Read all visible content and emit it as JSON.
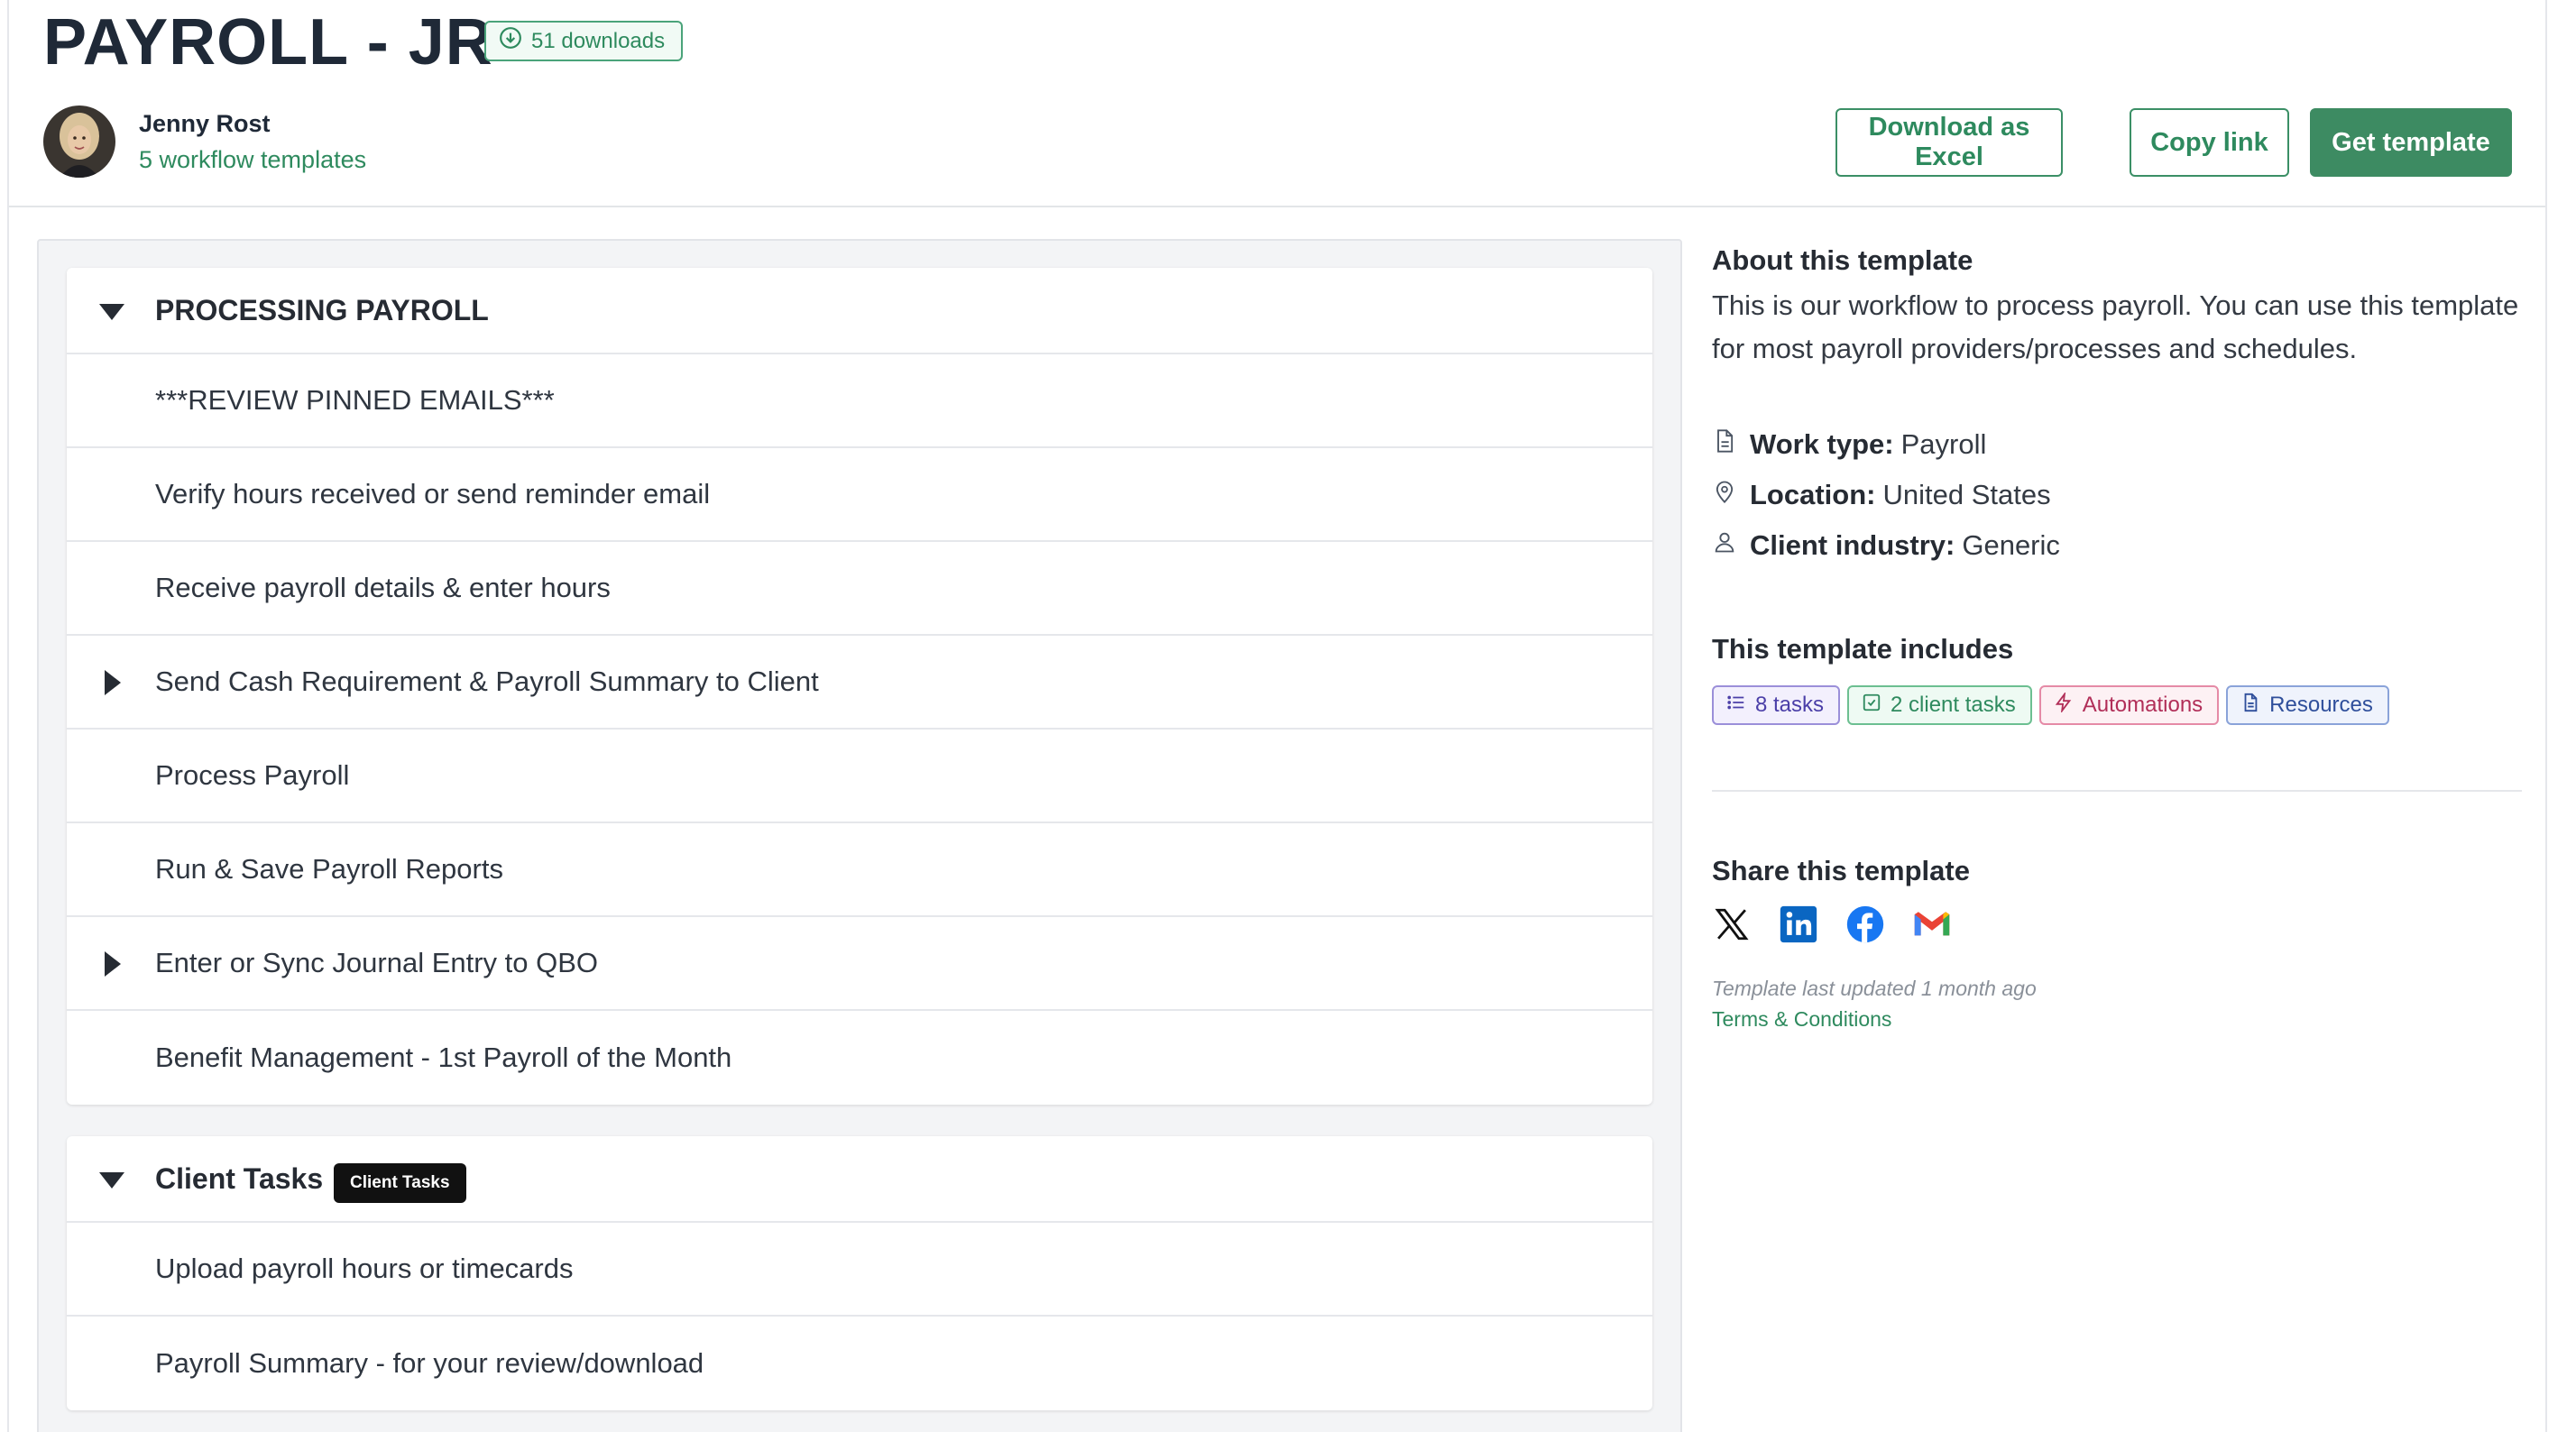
{
  "header": {
    "title": "PAYROLL - JR",
    "downloads": "51 downloads",
    "author": {
      "name": "Jenny Rost",
      "templates_link": "5 workflow templates"
    },
    "buttons": {
      "excel": "Download as Excel",
      "copy": "Copy link",
      "get": "Get template"
    }
  },
  "sections": [
    {
      "title": "PROCESSING PAYROLL",
      "expanded": true,
      "rows": [
        {
          "label": "***REVIEW PINNED EMAILS***",
          "expandable": false
        },
        {
          "label": "Verify hours received or send reminder email",
          "expandable": false
        },
        {
          "label": "Receive payroll details & enter hours",
          "expandable": false
        },
        {
          "label": "Send Cash Requirement & Payroll Summary to Client",
          "expandable": true
        },
        {
          "label": "Process Payroll",
          "expandable": false
        },
        {
          "label": "Run & Save Payroll Reports",
          "expandable": false
        },
        {
          "label": "Enter or Sync Journal Entry to QBO",
          "expandable": true
        },
        {
          "label": "Benefit Management - 1st Payroll of the Month",
          "expandable": false
        }
      ]
    },
    {
      "title": "Client Tasks",
      "tag": "Client Tasks",
      "expanded": true,
      "rows": [
        {
          "label": "Upload payroll hours or timecards",
          "expandable": false
        },
        {
          "label": "Payroll Summary - for your review/download",
          "expandable": false
        }
      ]
    }
  ],
  "sidebar": {
    "about_title": "About this template",
    "about_text": "This is our workflow to process payroll. You can use this template for most payroll providers/processes and schedules.",
    "meta": [
      {
        "icon": "document-icon",
        "label": "Work type:",
        "value": "Payroll"
      },
      {
        "icon": "location-pin-icon",
        "label": "Location:",
        "value": "United States"
      },
      {
        "icon": "person-icon",
        "label": "Client industry:",
        "value": "Generic"
      }
    ],
    "includes_title": "This template includes",
    "chips": {
      "tasks": "8 tasks",
      "client_tasks": "2 client tasks",
      "automations": "Automations",
      "resources": "Resources"
    },
    "share_title": "Share this template",
    "share_icons": [
      "x-icon",
      "linkedin-icon",
      "facebook-icon",
      "gmail-icon"
    ],
    "updated": "Template last updated 1 month ago",
    "terms": "Terms & Conditions"
  },
  "colors": {
    "brand_green": "#3d8b62",
    "text_dark": "#1f2937",
    "panel_bg": "#f3f4f6"
  }
}
